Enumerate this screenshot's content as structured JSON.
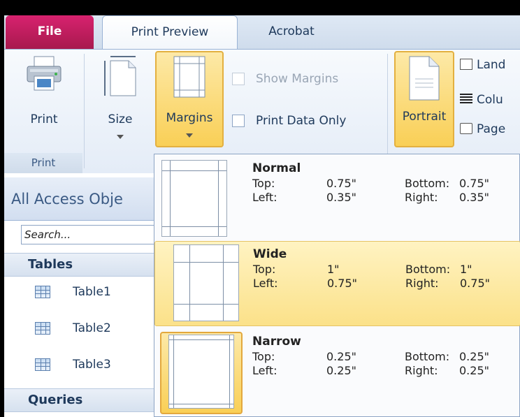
{
  "ribbon": {
    "tabs": {
      "file": "File",
      "print_preview": "Print Preview",
      "acrobat": "Acrobat"
    },
    "buttons": {
      "print": "Print",
      "size": "Size",
      "margins": "Margins",
      "portrait": "Portrait"
    },
    "checkboxes": {
      "show_margins": "Show Margins",
      "print_data_only": "Print Data Only"
    },
    "small_buttons": {
      "landscape": "Land",
      "columns": "Colu",
      "page_setup": "Page"
    },
    "group_labels": {
      "print": "Print"
    }
  },
  "nav": {
    "header": "All Access Obje",
    "search_placeholder": "Search...",
    "sections": {
      "tables": "Tables",
      "queries": "Queries"
    },
    "tables": [
      "Table1",
      "Table2",
      "Table3"
    ]
  },
  "margins_menu": {
    "options": [
      {
        "name": "Normal",
        "top_label": "Top:",
        "top": "0.75\"",
        "bottom_label": "Bottom:",
        "bottom": "0.75\"",
        "left_label": "Left:",
        "left": "0.35\"",
        "right_label": "Right:",
        "right": "0.35\""
      },
      {
        "name": "Wide",
        "top_label": "Top:",
        "top": "1\"",
        "bottom_label": "Bottom:",
        "bottom": "1\"",
        "left_label": "Left:",
        "left": "0.75\"",
        "right_label": "Right:",
        "right": "0.75\""
      },
      {
        "name": "Narrow",
        "top_label": "Top:",
        "top": "0.25\"",
        "bottom_label": "Bottom:",
        "bottom": "0.25\"",
        "left_label": "Left:",
        "left": "0.25\"",
        "right_label": "Right:",
        "right": "0.25\""
      }
    ]
  },
  "colors": {
    "file_tab": "#c11d5f",
    "highlight": "#f9cf56",
    "hover": "#fbe189"
  }
}
